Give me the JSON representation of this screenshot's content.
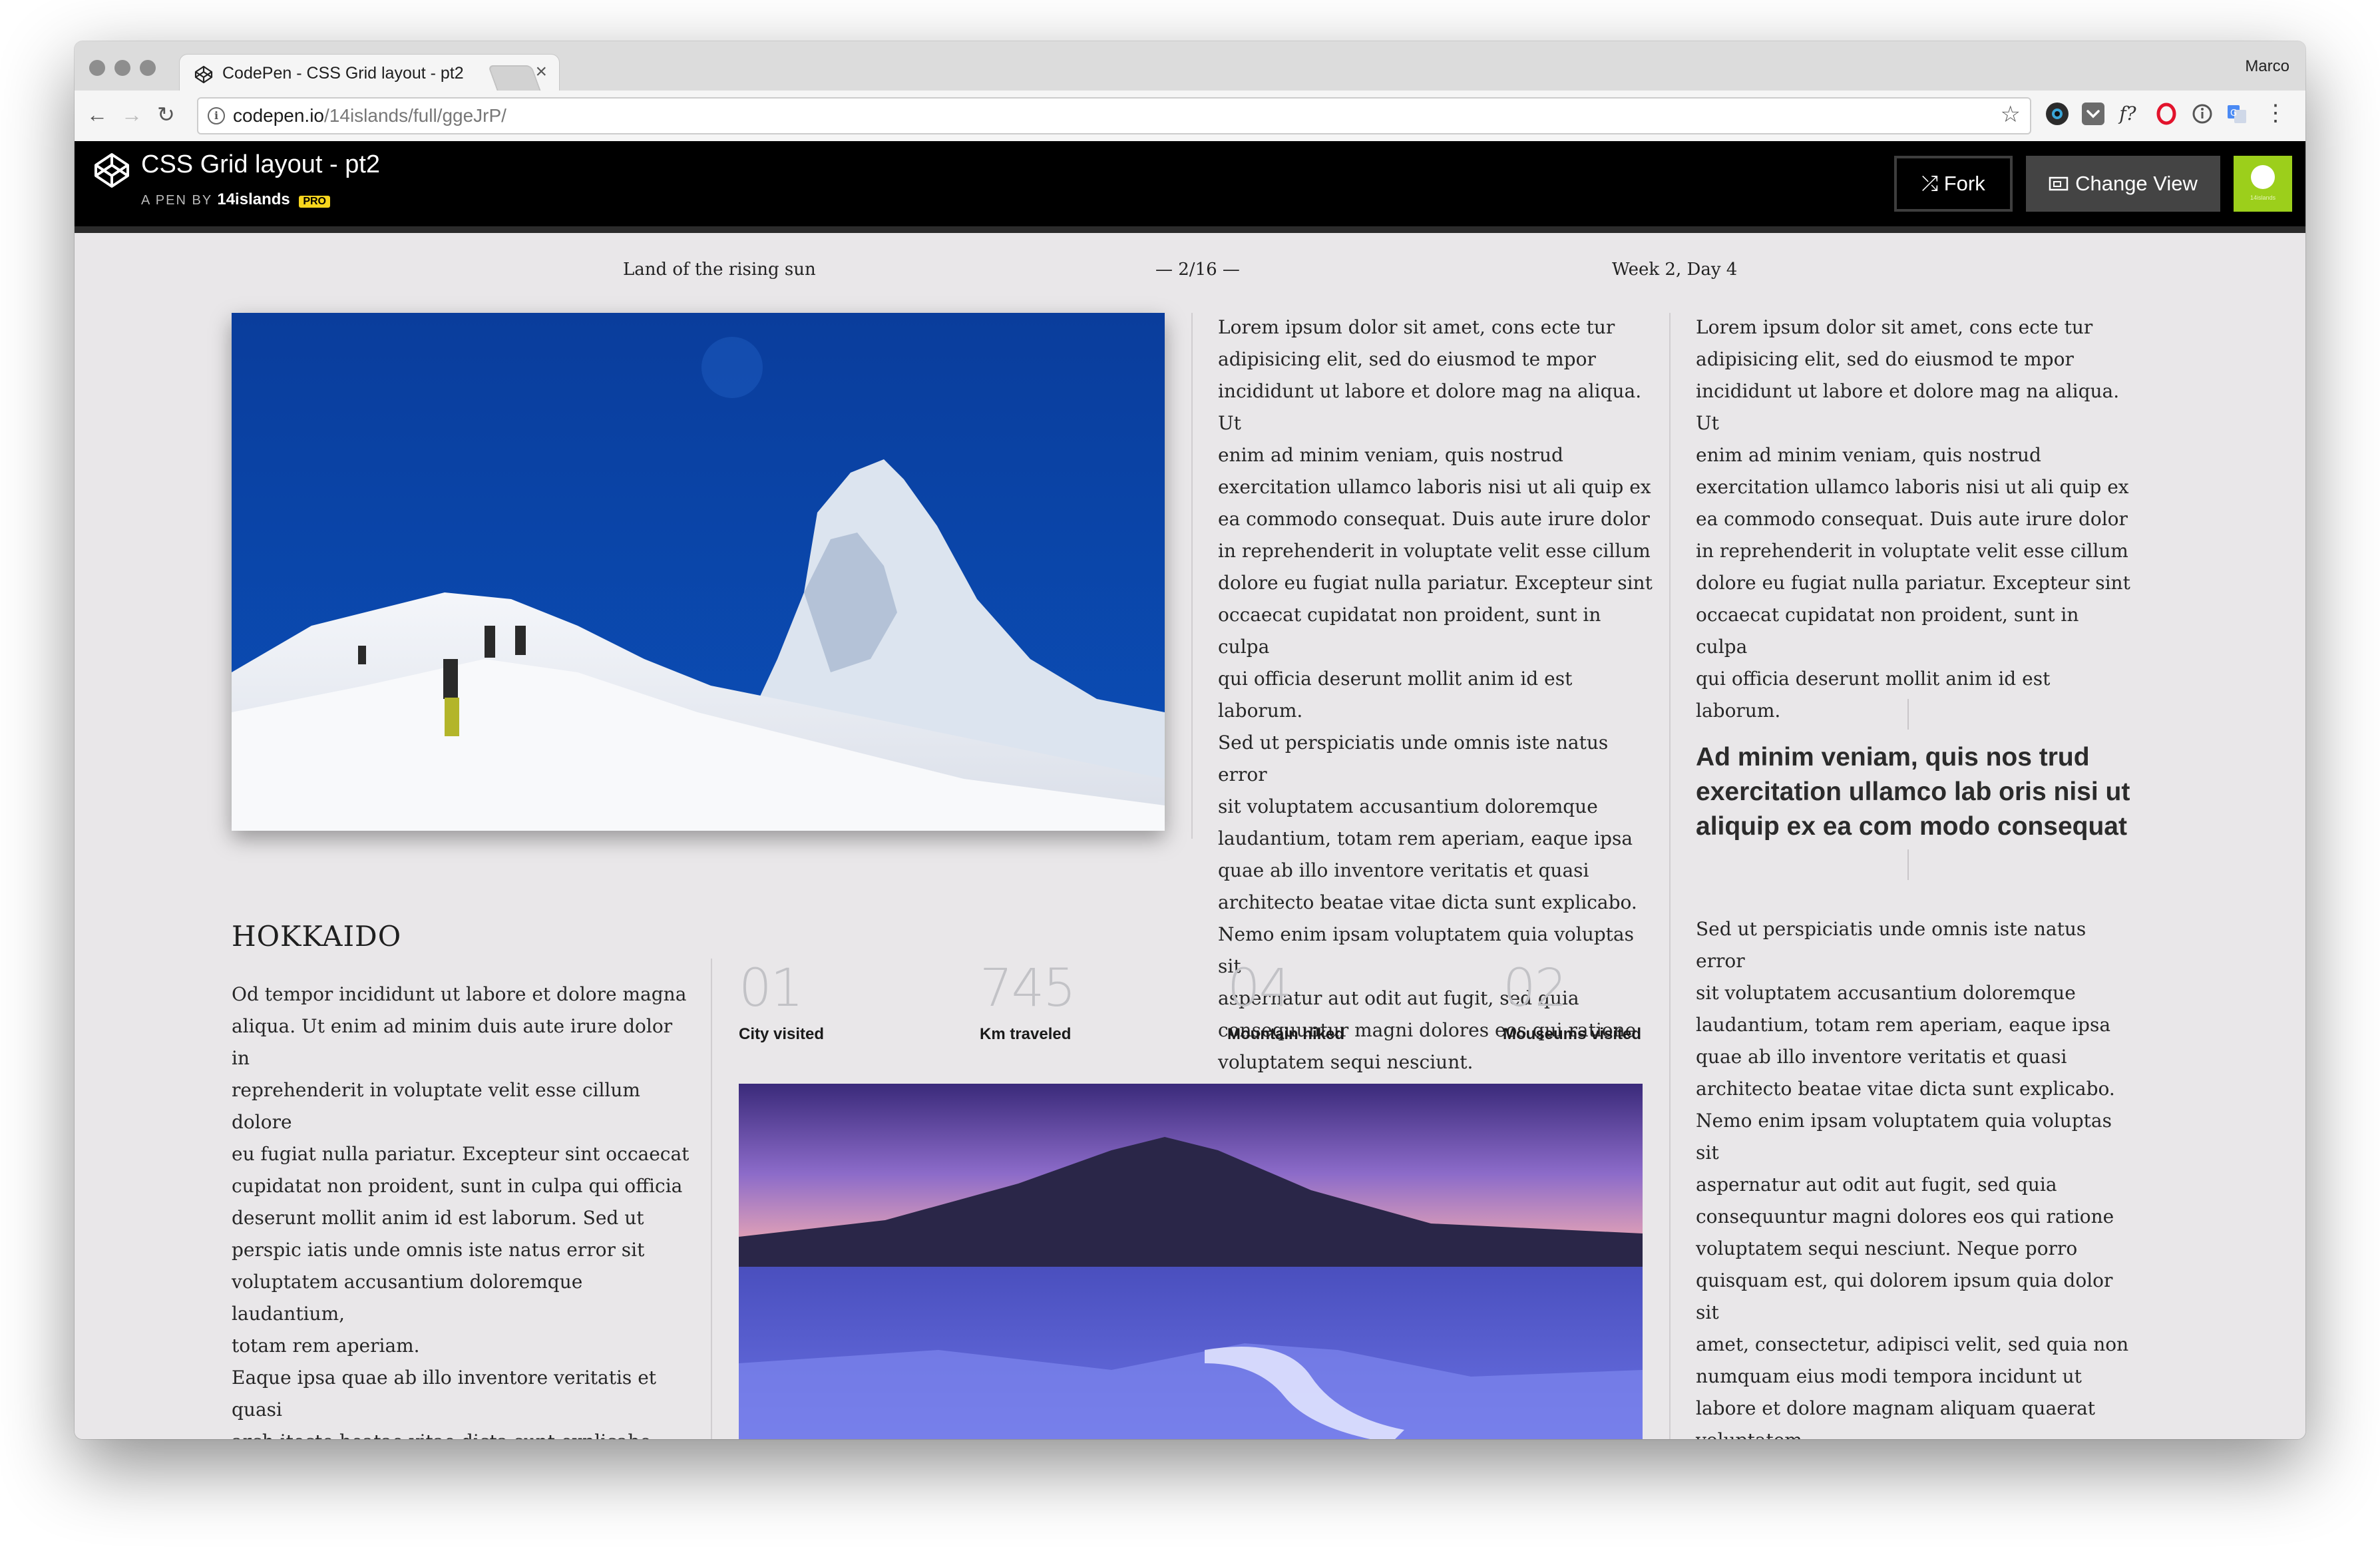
{
  "browser": {
    "tab_title": "CodePen - CSS Grid layout - pt2",
    "tab_close": "×",
    "profile_name": "Marco",
    "nav": {
      "back": "←",
      "forward": "→",
      "reload": "↻"
    },
    "url_host": "codepen.io",
    "url_path": "/14islands/full/ggeJrP/",
    "star": "☆",
    "info": "i",
    "extensions": [
      "camera-icon",
      "pocket-icon",
      "font-icon",
      "opera-icon",
      "info-icon",
      "translate-icon"
    ],
    "ext_labels": {
      "font": "f?"
    },
    "menu": "⋮"
  },
  "codepen": {
    "pen_title": "CSS Grid layout - pt2",
    "author_prefix": "A PEN BY",
    "author": "14islands",
    "pro_badge": "PRO",
    "fork_label": "Fork",
    "fork_icon": "⤮",
    "change_view_label": "Change View",
    "avatar_text": "14islands",
    "avatar_color": "#9ccf1b"
  },
  "page": {
    "header_left": "Land of the rising sun",
    "header_center": "— 2/16 —",
    "header_right": "Week 2, Day 4",
    "column_mid_text": "Lorem ipsum dolor sit amet, cons ecte tur\nadipisicing elit, sed do eiusmod te mpor\nincididunt ut labore et dolore mag na aliqua. Ut\nenim ad minim veniam, quis nostrud\nexercitation ullamco laboris nisi ut ali quip ex\nea commodo consequat. Duis aute irure dolor\nin reprehenderit in voluptate velit esse cillum\ndolore eu fugiat nulla pariatur. Excepteur sint\noccaecat cupidatat non proident, sunt in culpa\nqui officia deserunt mollit anim id est laborum.\nSed ut perspiciatis unde omnis iste natus error\nsit voluptatem accusantium doloremque\nlaudantium, totam rem aperiam, eaque ipsa\nquae ab illo inventore veritatis et quasi\narchitecto beatae vitae dicta sunt explicabo.\nNemo enim ipsam voluptatem quia voluptas sit\naspernatur aut odit aut fugit, sed quia\nconsequuntur magni dolores eos qui ratione\nvoluptatem sequi nesciunt.",
    "column_right_top_text": "Lorem ipsum dolor sit amet, cons ecte tur\nadipisicing elit, sed do eiusmod te mpor\nincididunt ut labore et dolore mag na aliqua. Ut\nenim ad minim veniam, quis nostrud\nexercitation ullamco laboris nisi ut ali quip ex\nea commodo consequat. Duis aute irure dolor\nin reprehenderit in voluptate velit esse cillum\ndolore eu fugiat nulla pariatur. Excepteur sint\noccaecat cupidatat non proident, sunt in culpa\nqui officia deserunt mollit anim id est laborum.",
    "pull_quote": "Ad minim veniam, quis nos trud exercitation ullamco lab oris nisi ut aliquip ex ea com modo consequat",
    "column_right_bottom_text": "Sed ut perspiciatis unde omnis iste natus error\nsit voluptatem accusantium doloremque\nlaudantium, totam rem aperiam, eaque ipsa\nquae ab illo inventore veritatis et quasi\narchitecto beatae vitae dicta sunt explicabo.\nNemo enim ipsam voluptatem quia voluptas sit\naspernatur aut odit aut fugit, sed quia\nconsequuntur magni dolores eos qui ratione\nvoluptatem sequi nesciunt. Neque porro\nquisquam est, qui dolorem ipsum quia dolor sit\namet, consectetur, adipisci velit, sed quia non\nnumquam eius modi tempora incidunt ut\nlabore et dolore magnam aliquam quaerat\nvoluptatem.",
    "section_title": "HOKKAIDO",
    "section_text": "Od tempor incididunt ut labore et dolore magna\naliqua. Ut enim ad minim duis aute irure dolor in\nreprehenderit in voluptate velit esse cillum dolore\neu fugiat nulla pariatur. Excepteur sint occaecat\ncupidatat non proident, sunt in culpa qui officia\ndeserunt mollit anim id est laborum. Sed ut\nperspic iatis unde omnis iste natus error sit\nvoluptatem accusantium doloremque laudantium,\ntotam rem aperiam.\nEaque ipsa quae ab illo inventore veritatis et quasi\narch itecto beatae vitae dicta sunt explicabo.\nNemo enim ipsam volupta tem quia voluptas sit\naspernatur aut odit aut fugit, sed quia\nconsequuntur magni dolores eos qui ratione",
    "stats": [
      {
        "value": "01",
        "label": "City visited"
      },
      {
        "value": "745",
        "label": "Km traveled"
      },
      {
        "value": "04",
        "label": "Mountain hiked"
      },
      {
        "value": "02",
        "label": "Mouseums visited"
      }
    ]
  }
}
